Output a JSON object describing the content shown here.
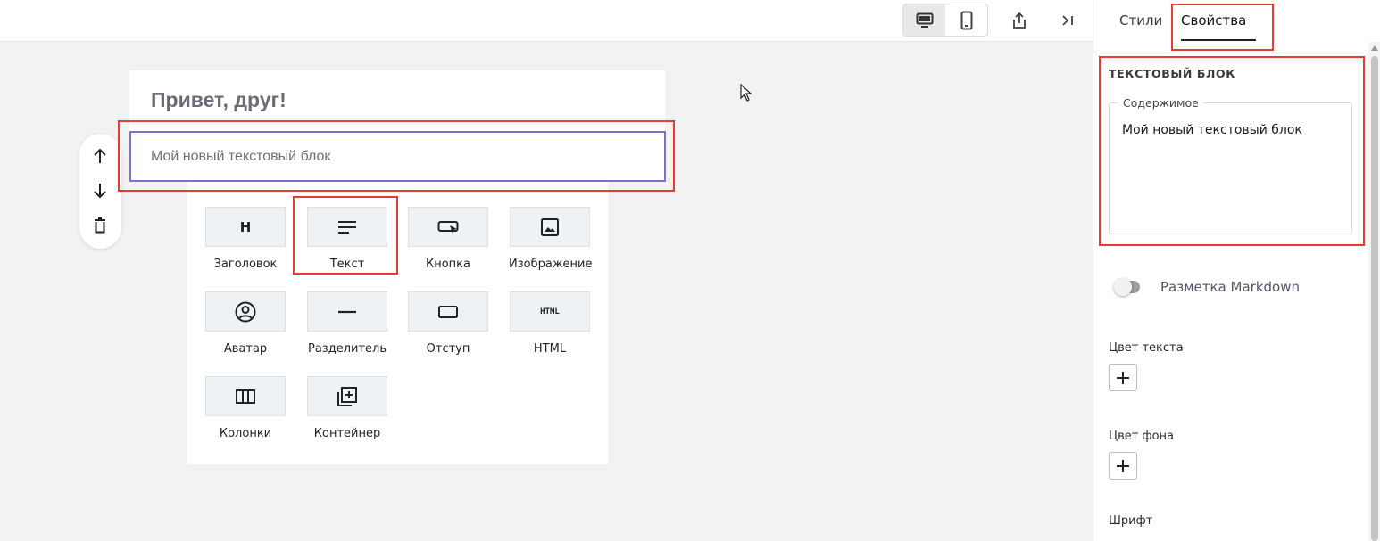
{
  "toolbar": {
    "devices": [
      {
        "name": "desktop",
        "icon": "monitor-icon",
        "active": true
      },
      {
        "name": "mobile",
        "icon": "smartphone-icon",
        "active": false
      }
    ],
    "share_icon": "share-icon",
    "collapse_icon": "collapse-panel-icon"
  },
  "canvas": {
    "heading": "Привет, друг!",
    "text_block": "Мой новый текстовый блок",
    "controls": [
      "arrow-up-icon",
      "arrow-down-icon",
      "trash-icon"
    ]
  },
  "picker": {
    "items": [
      {
        "label": "Заголовок",
        "icon": "heading-icon"
      },
      {
        "label": "Текст",
        "icon": "text-lines-icon"
      },
      {
        "label": "Кнопка",
        "icon": "button-cursor-icon"
      },
      {
        "label": "Изображение",
        "icon": "image-icon"
      },
      {
        "label": "Аватар",
        "icon": "avatar-icon"
      },
      {
        "label": "Разделитель",
        "icon": "divider-icon"
      },
      {
        "label": "Отступ",
        "icon": "spacer-icon"
      },
      {
        "label": "HTML",
        "icon": "html-icon"
      },
      {
        "label": "Колонки",
        "icon": "columns-icon"
      },
      {
        "label": "Контейнер",
        "icon": "container-icon"
      }
    ],
    "heading_glyph": "H",
    "html_glyph": "HTML"
  },
  "panel": {
    "tabs": [
      {
        "label": "Стили",
        "active": false
      },
      {
        "label": "Свойства",
        "active": true
      }
    ],
    "section_title": "ТЕКСТОВЫЙ БЛОК",
    "content_label": "Содержимое",
    "content_value": "Мой новый текстовый блок",
    "markdown_label": "Разметка Markdown",
    "markdown_enabled": false,
    "text_color_label": "Цвет текста",
    "bg_color_label": "Цвет фона",
    "font_label": "Шрифт"
  },
  "colors": {
    "selection_border": "#7b6fd6",
    "annotation_red": "#e53b30"
  }
}
